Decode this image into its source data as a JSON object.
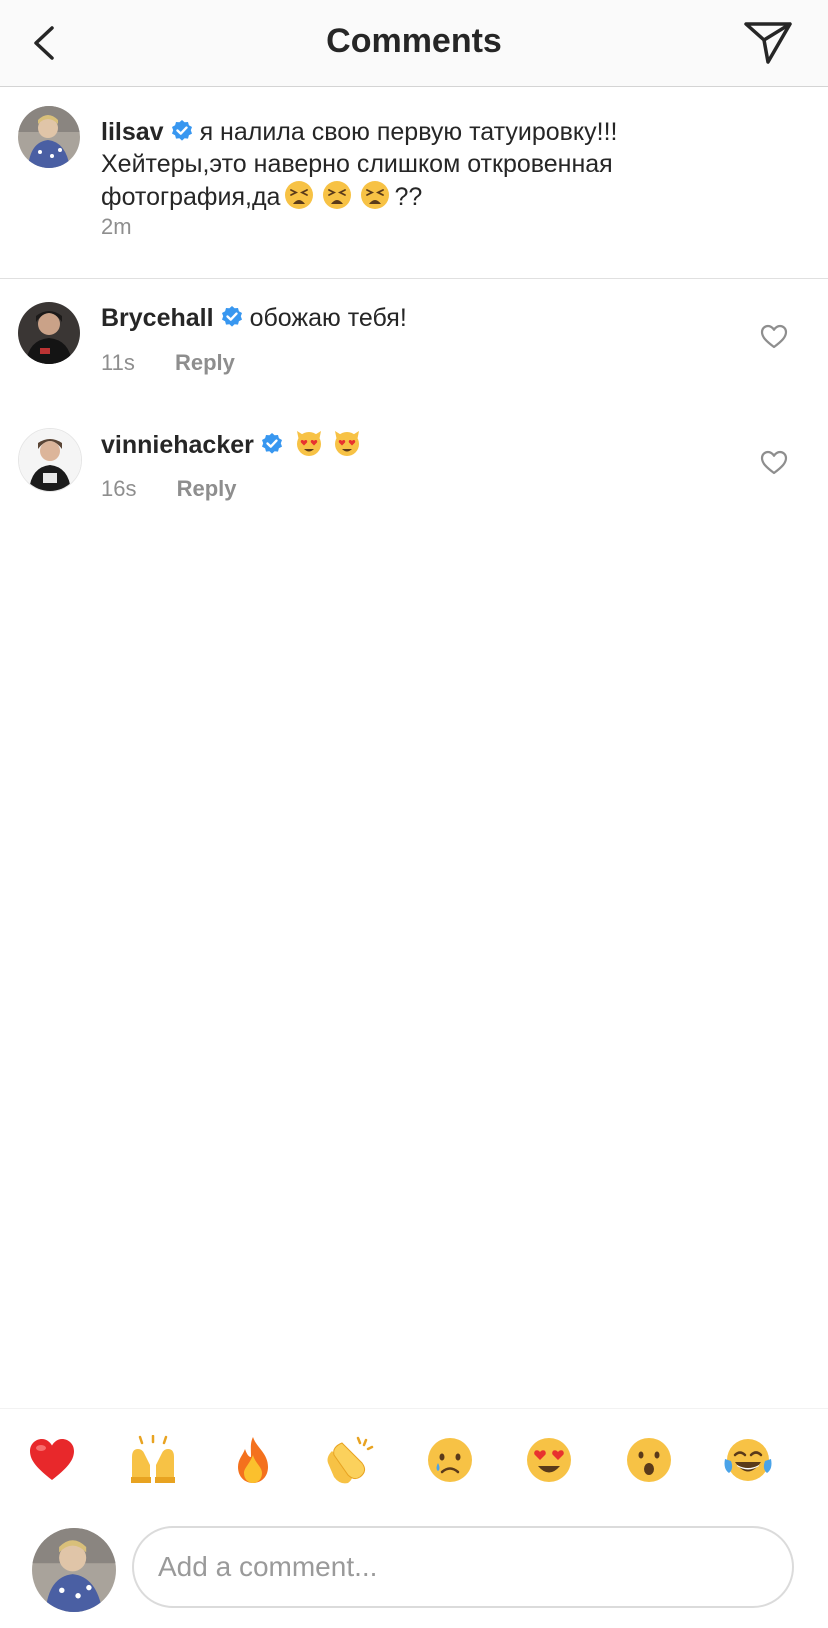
{
  "header": {
    "title": "Comments"
  },
  "caption": {
    "username": "lilsav",
    "text_line1": "я налила свою первую татуировку!!!",
    "text_line2": "Хейтеры,это наверно слишком откровенная",
    "text_line3_prefix": "фотография,да",
    "text_line3_suffix": "??",
    "time": "2m"
  },
  "comments": [
    {
      "username": "Brycehall",
      "text": "обожаю тебя!",
      "time": "11s",
      "reply_label": "Reply"
    },
    {
      "username": "vinniehacker",
      "text": "",
      "time": "16s",
      "reply_label": "Reply"
    }
  ],
  "reactions": [
    "heart",
    "raised-hands",
    "fire",
    "clapping-hands",
    "crying-face",
    "heart-eyes-face",
    "surprised-face",
    "tears-of-joy-face"
  ],
  "input": {
    "placeholder": "Add a comment..."
  },
  "colors": {
    "verified": "#3897f0",
    "text": "#262626",
    "secondary": "#8e8e8e"
  }
}
